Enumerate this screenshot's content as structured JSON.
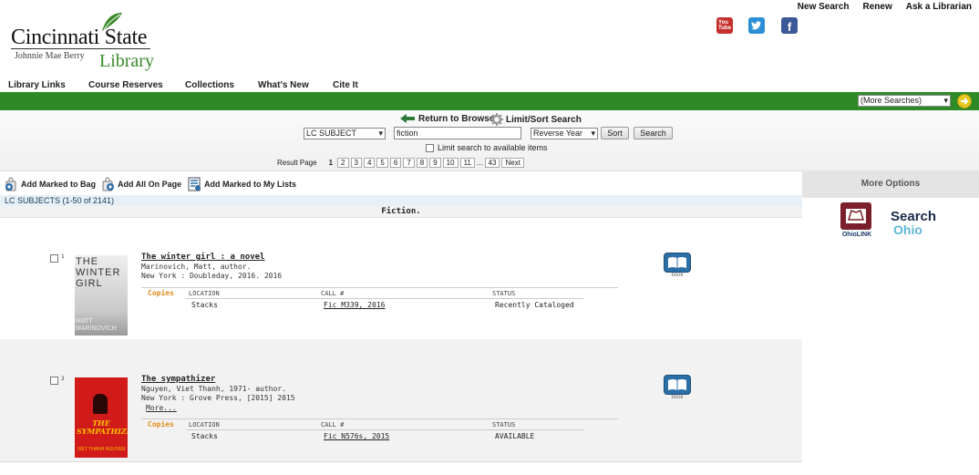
{
  "logo": {
    "name": "Cincinnati State",
    "subname": "Johnnie Mae Berry",
    "library": "Library"
  },
  "top_links": [
    "New Search",
    "Renew",
    "Ask a Librarian"
  ],
  "social_icons": [
    "youtube-icon",
    "twitter-icon",
    "facebook-icon"
  ],
  "nav_links": [
    "Library Links",
    "Course Reserves",
    "Collections",
    "What's New",
    "Cite It"
  ],
  "more_searches": "(More Searches)",
  "browse": {
    "return_label": "Return to Browse",
    "limit_label": "Limit/Sort Search"
  },
  "search": {
    "index": "LC SUBJECT",
    "query": "fiction",
    "sort_order": "Reverse Year",
    "sort_button": "Sort",
    "search_button": "Search",
    "limit_label": "Limit search to available items"
  },
  "pager": {
    "label": "Result Page",
    "current": "1",
    "pages": [
      "2",
      "3",
      "4",
      "5",
      "6",
      "7",
      "8",
      "9",
      "10",
      "11"
    ],
    "ellipsis": "...",
    "last": "43",
    "next": "Next"
  },
  "bag_actions": [
    "Add Marked to Bag",
    "Add All On Page",
    "Add Marked to My Lists"
  ],
  "subjects_header": "LC SUBJECTS (1-50 of 2141)",
  "subject_heading": "Fiction.",
  "more_options": "More Options",
  "ohiolink_label": "OhioLINK",
  "search_ohio": [
    "Search",
    "Ohio"
  ],
  "copies_headers": {
    "copies": "Copies",
    "location": "LOCATION",
    "call": "CALL #",
    "status": "STATUS"
  },
  "results": [
    {
      "number": "1",
      "title": "The winter girl : a novel",
      "author": "Marinovich, Matt, author.",
      "publisher": "New York : Doubleday, 2016. 2016",
      "more": "",
      "location": "Stacks",
      "call": "Fic M339, 2016",
      "status": "Recently Cataloged",
      "format": "book",
      "cover_title": [
        "THE",
        "WINTER",
        "GIRL"
      ],
      "cover_author": [
        "MATT",
        "MARINOVICH"
      ]
    },
    {
      "number": "2",
      "title": "The sympathizer",
      "author": "Nguyen, Viet Thanh, 1971- author.",
      "publisher": "New York : Grove Press, [2015] 2015",
      "more": "More...",
      "location": "Stacks",
      "call": "Fic N576s, 2015",
      "status": "AVAILABLE",
      "format": "book",
      "cover_title": [
        "THE",
        "SYMPATHIZER"
      ],
      "cover_author": [
        "VIET THANH NGUYEN"
      ]
    }
  ],
  "colors": {
    "green": "#2d8a27",
    "copies": "#e08a1a",
    "book_icon": "#2c6ea6"
  }
}
